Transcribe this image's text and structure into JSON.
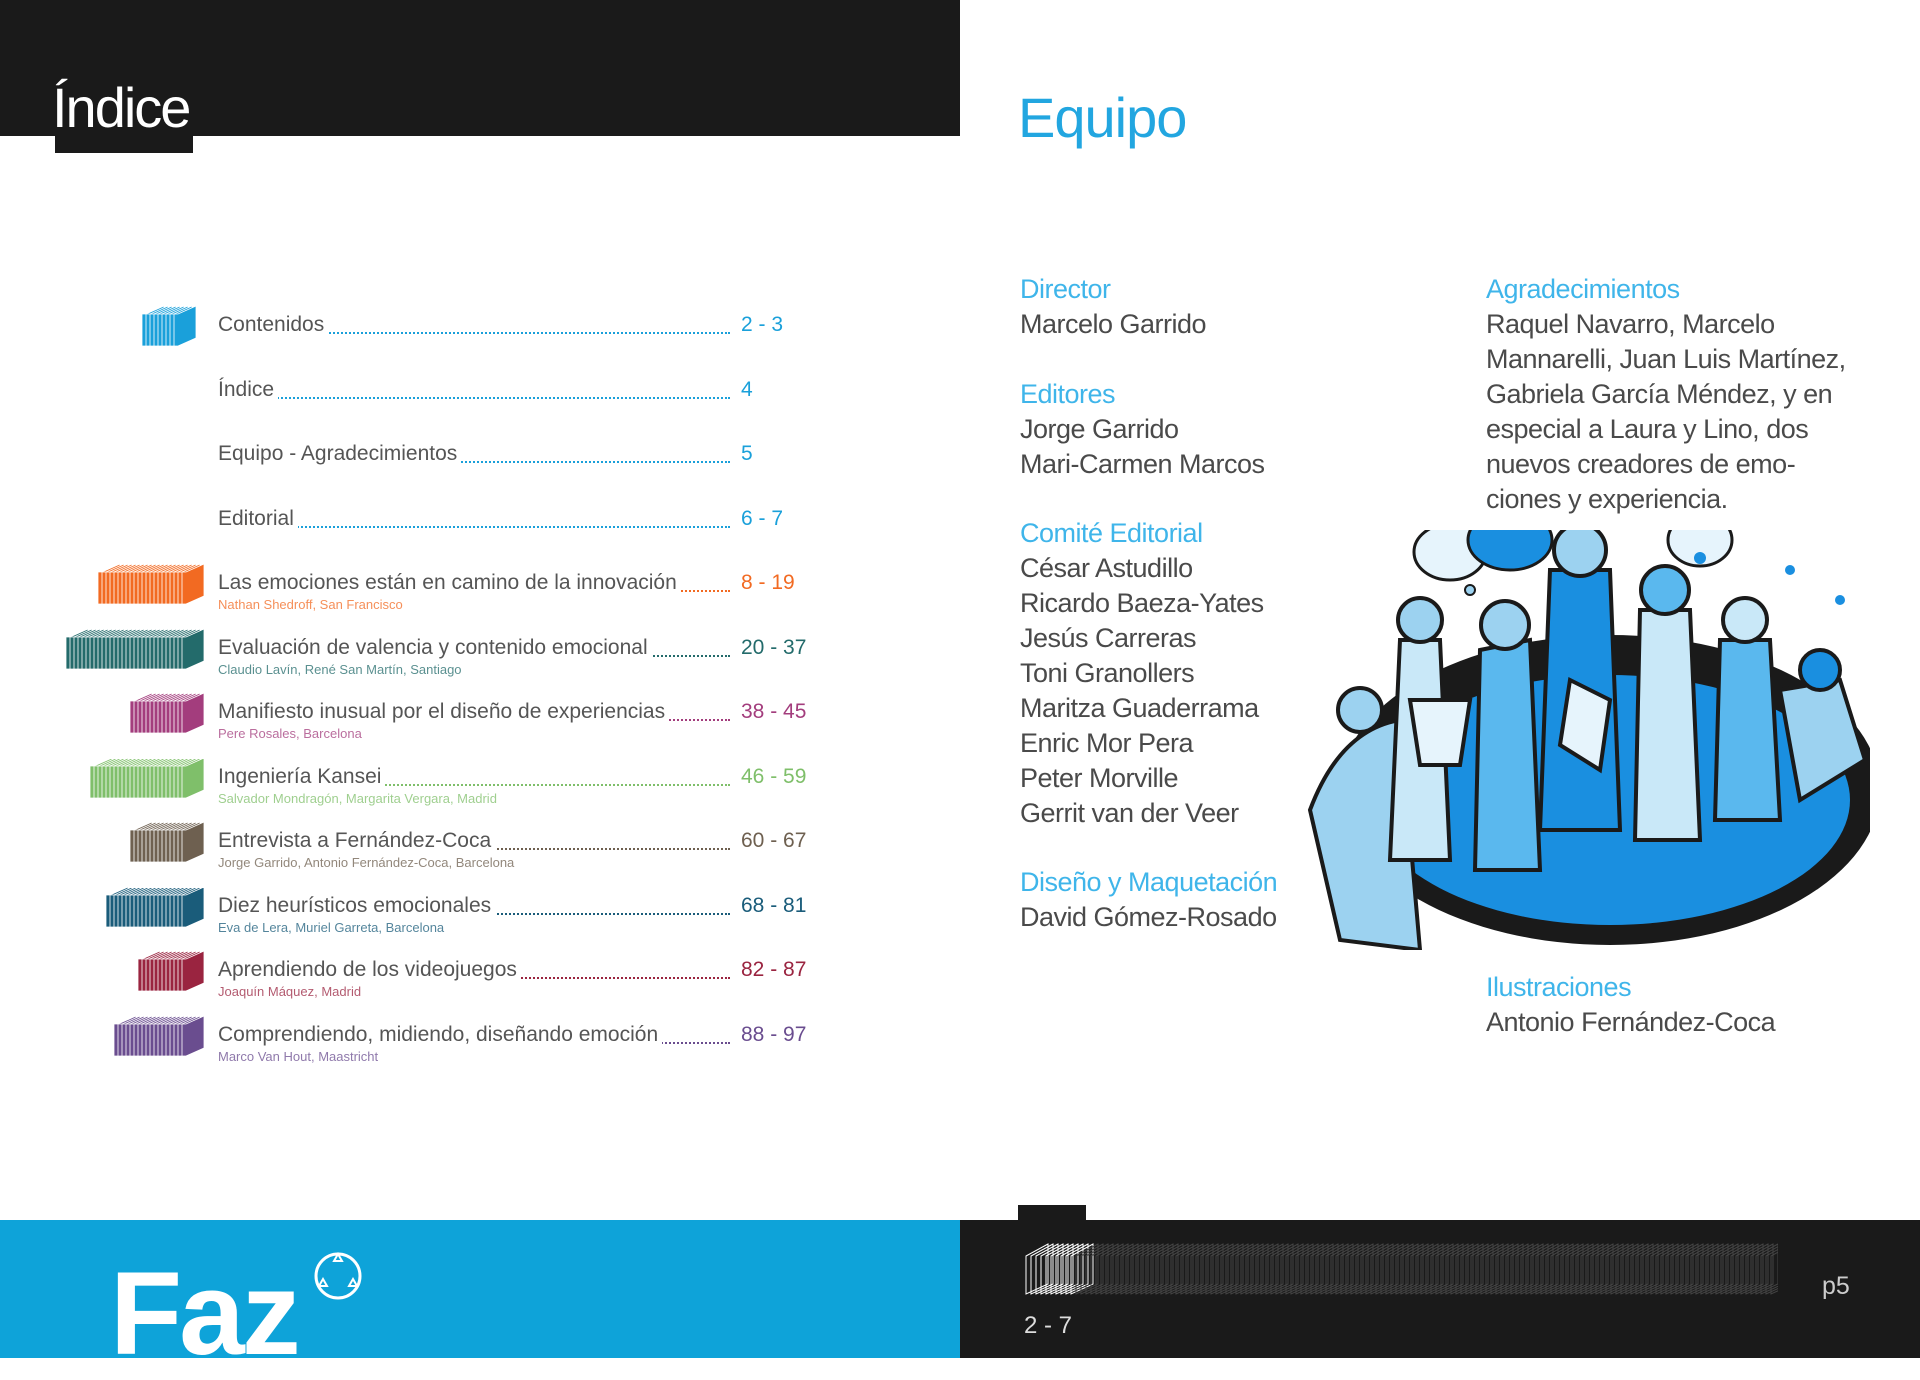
{
  "indice": {
    "title": "Índice",
    "items": [
      {
        "title": "Contenidos",
        "pages": "2 - 3",
        "author": "",
        "color": "#1aa0da"
      },
      {
        "title": "Índice",
        "pages": "4",
        "author": "",
        "color": "#1aa0da"
      },
      {
        "title": "Equipo - Agradecimientos",
        "pages": "5",
        "author": "",
        "color": "#1aa0da"
      },
      {
        "title": "Editorial",
        "pages": "6 - 7",
        "author": "",
        "color": "#1aa0da"
      },
      {
        "title": "Las emociones están en camino de la innovación",
        "pages": "8 - 19",
        "author": "Nathan Shedroff, San Francisco",
        "color": "#f26a22"
      },
      {
        "title": "Evaluación de valencia y contenido emocional",
        "pages": "20 - 37",
        "author": "Claudio Lavín, René San Martín, Santiago",
        "color": "#236b6b"
      },
      {
        "title": "Manifiesto inusual por el diseño de experiencias",
        "pages": "38 - 45",
        "author": "Pere Rosales, Barcelona",
        "color": "#a33d7d"
      },
      {
        "title": "Ingeniería Kansei",
        "pages": "46 - 59",
        "author": "Salvador Mondragón, Margarita Vergara, Madrid",
        "color": "#7fbf6a"
      },
      {
        "title": "Entrevista a Fernández-Coca",
        "pages": "60 - 67",
        "author": "Jorge Garrido, Antonio Fernández-Coca, Barcelona",
        "color": "#6e6050"
      },
      {
        "title": "Diez heurísticos emocionales",
        "pages": "68 - 81",
        "author": "Eva de Lera, Muriel Garreta, Barcelona",
        "color": "#1a5c7a"
      },
      {
        "title": "Aprendiendo de los videojuegos",
        "pages": "82 - 87",
        "author": "Joaquín Máquez, Madrid",
        "color": "#9a2440"
      },
      {
        "title": "Comprendiendo, midiendo, diseñando emoción",
        "pages": "88 - 97",
        "author": "Marco Van Hout, Maastricht",
        "color": "#6a4d8f"
      }
    ]
  },
  "equipo": {
    "title": "Equipo",
    "director": {
      "role": "Director",
      "members": [
        "Marcelo Garrido"
      ]
    },
    "editores": {
      "role": "Editores",
      "members": [
        "Jorge Garrido",
        "Mari-Carmen Marcos"
      ]
    },
    "comite": {
      "role": "Comité Editorial",
      "members": [
        "César Astudillo",
        "Ricardo Baeza-Yates",
        "Jesús Carreras",
        "Toni Granollers",
        "Maritza Guaderrama",
        "Enric Mor Pera",
        "Peter Morville",
        "Gerrit van der Veer"
      ]
    },
    "diseno": {
      "role": "Diseño y Maquetación",
      "members": [
        "David Gómez-Rosado"
      ]
    },
    "agradecimientos": {
      "role": "Agradecimientos",
      "text": "Raquel Navarro, Marcelo Mannarelli, Juan Luis Martínez, Gabriela García Méndez, y en especial a Laura y Lino, dos nuevos creadores de emo-ciones y experiencia."
    },
    "ilustraciones": {
      "role": "Ilustraciones",
      "members": [
        "Antonio Fernández-Coca"
      ]
    }
  },
  "footer": {
    "logo": "Faz",
    "range": "2 - 7",
    "page": "p5"
  },
  "colors": {
    "accent": "#0ea3d9",
    "dark": "#1a1a1a"
  }
}
